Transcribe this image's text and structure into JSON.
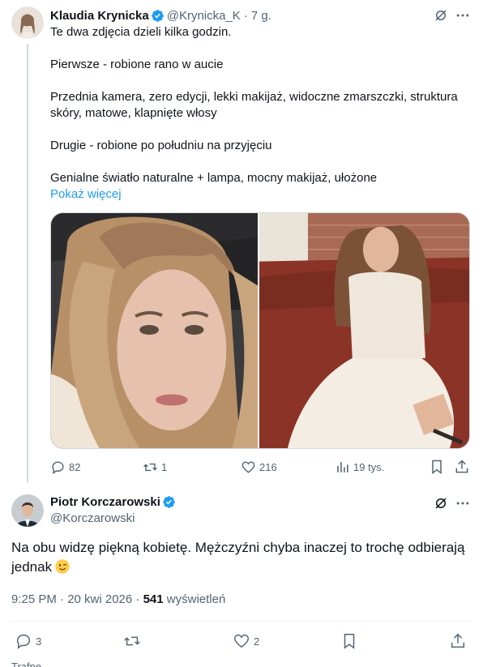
{
  "parent_tweet": {
    "author_name": "Klaudia Krynicka",
    "handle": "@Krynicka_K",
    "time": "7 g.",
    "lines": [
      "Te dwa zdjęcia dzieli kilka godzin.",
      "Pierwsze - robione rano w aucie",
      "Przednia kamera, zero edycji, lekki makijaż, widoczne zmarszczki, struktura skóry, matowe, klapnięte włosy",
      "Drugie - robione po południu na przyjęciu",
      "Genialne światło naturalne + lampa, mocny makijaż, ułożone"
    ],
    "show_more": "Pokaż więcej",
    "stats": {
      "replies": "82",
      "reposts": "1",
      "likes": "216",
      "views": "19 tys."
    }
  },
  "main_tweet": {
    "author_name": "Piotr Korczarowski",
    "handle": "@Korczarowski",
    "text": "Na obu widzę piękną kobietę. Mężczyźni chyba inaczej to trochę odbierają jednak",
    "emoji": "winking-face",
    "time": "9:25 PM · 20 kwi 2026 · ",
    "views_count": "541",
    "views_label": " wyświetleń",
    "stats": {
      "replies": "3",
      "reposts": "",
      "likes": "2"
    }
  },
  "footer_text": "Trafne",
  "colors": {
    "accent": "#1d9bf0",
    "muted": "#536471",
    "text": "#0f1419",
    "line": "#cfd9de"
  }
}
